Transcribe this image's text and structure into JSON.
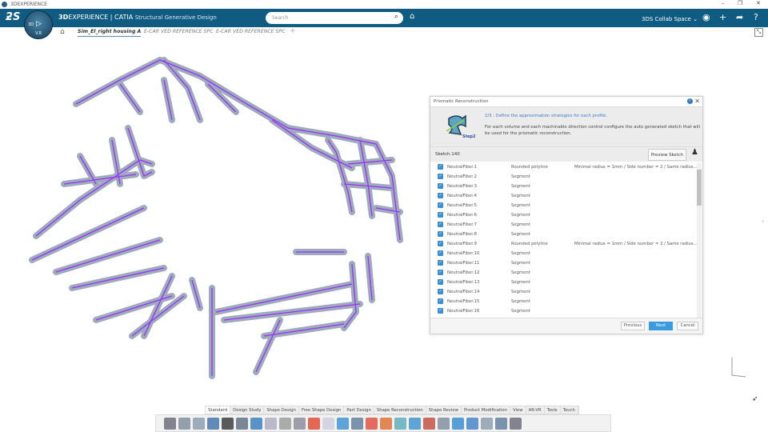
{
  "window": {
    "title": "3DEXPERIENCE",
    "minimize": "–",
    "restore": "❐",
    "close": "✕"
  },
  "topbar": {
    "brand_bold": "3D",
    "brand_rest": "EXPERIENCE | CATIA",
    "app": "Structural Generative Design",
    "search_placeholder": "Search",
    "space": "3DS Collab Space ⌄",
    "compass_version": "V.R",
    "compass_3d": "3D"
  },
  "tabs": [
    {
      "label": "Sim_El_right housing A",
      "active": true
    },
    {
      "label": "E-CAR VED REFERENCE SPC"
    },
    {
      "label": "E-CAR VED REFERENCE SPC"
    }
  ],
  "dialog": {
    "title": "Prismatic Reconstruction",
    "step_label": "Step2",
    "step_title": "2/3 : Define the approximation strategies for each profile.",
    "step_desc": "For each volume and each machinable direction control configure the auto generated sketch that will be used for the prismatic reconstruction.",
    "sketch": "Sketch.140",
    "preview": "Preview Sketch",
    "rows": [
      {
        "name": "NeutralFiber.1",
        "method": "Rounded polyline",
        "detail": "Minimal radius = 1mm / Side number = 2 / Same radius..."
      },
      {
        "name": "NeutralFiber.2",
        "method": "Segment",
        "detail": ""
      },
      {
        "name": "NeutralFiber.3",
        "method": "Segment",
        "detail": ""
      },
      {
        "name": "NeutralFiber.4",
        "method": "Segment",
        "detail": ""
      },
      {
        "name": "NeutralFiber.5",
        "method": "Segment",
        "detail": ""
      },
      {
        "name": "NeutralFiber.6",
        "method": "Segment",
        "detail": ""
      },
      {
        "name": "NeutralFiber.7",
        "method": "Segment",
        "detail": ""
      },
      {
        "name": "NeutralFiber.8",
        "method": "Segment",
        "detail": ""
      },
      {
        "name": "NeutralFiber.9",
        "method": "Rounded polyline",
        "detail": "Minimal radius = 1mm / Side number = 2 / Same radius..."
      },
      {
        "name": "NeutralFiber.10",
        "method": "Segment",
        "detail": ""
      },
      {
        "name": "NeutralFiber.11",
        "method": "Segment",
        "detail": ""
      },
      {
        "name": "NeutralFiber.12",
        "method": "Segment",
        "detail": ""
      },
      {
        "name": "NeutralFiber.13",
        "method": "Segment",
        "detail": ""
      },
      {
        "name": "NeutralFiber.14",
        "method": "Segment",
        "detail": ""
      },
      {
        "name": "NeutralFiber.15",
        "method": "Segment",
        "detail": ""
      },
      {
        "name": "NeutralFiber.16",
        "method": "Segment",
        "detail": ""
      }
    ],
    "buttons": {
      "previous": "Previous",
      "next": "Next",
      "cancel": "Cancel"
    }
  },
  "toolbar_tabs": [
    "Standard",
    "Design Study",
    "Shape Design",
    "Free Shape Design",
    "Part Design",
    "Shape Reconstruction",
    "Shape Review",
    "Product Modification",
    "View",
    "AR-VR",
    "Tools",
    "Touch"
  ],
  "active_toolbar_tab": "Standard",
  "toolbar_icons": [
    "cut",
    "copy",
    "paste",
    "undo",
    "zoom",
    "book",
    "update",
    "measure",
    "part",
    "import",
    "color-map",
    "section",
    "shape-a",
    "shape-b",
    "shape-c",
    "shape-d",
    "shape-e",
    "fibers",
    "chart-a",
    "chart-b",
    "move-a",
    "move-b",
    "assembly-a",
    "assembly-b",
    "render"
  ],
  "colors": {
    "topbar": "#0f5b82",
    "accent": "#3a9be0",
    "fiber": "#9b30ff",
    "mesh": "#8f9fae"
  }
}
